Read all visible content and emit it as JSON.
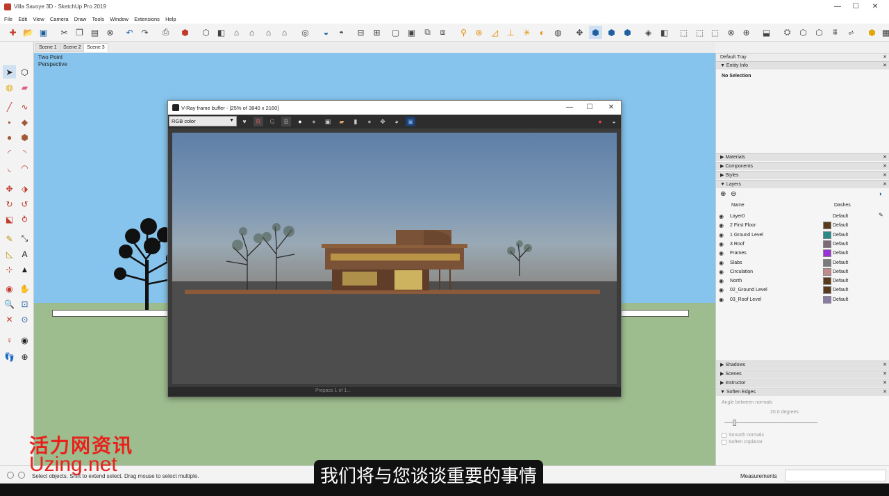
{
  "window": {
    "title": "Villa Savoye 3D - SketchUp Pro 2019"
  },
  "menu": [
    "File",
    "Edit",
    "View",
    "Camera",
    "Draw",
    "Tools",
    "Window",
    "Extensions",
    "Help"
  ],
  "scenes": {
    "tabs": [
      "Scene 1",
      "Scene 2",
      "Scene 3"
    ],
    "active": "Scene 3"
  },
  "viewport": {
    "label_line1": "Two Point",
    "label_line2": "Perspective"
  },
  "vfb": {
    "title": "V-Ray frame buffer - [25% of 3840 x 2160]",
    "channel": "RGB color",
    "channel_buttons": [
      "R",
      "G",
      "B"
    ],
    "status": "Prepass 1 of 1..."
  },
  "tray": {
    "title": "Default Tray",
    "entity_info": {
      "header": "Entity Info",
      "value": "No Selection"
    },
    "panels_top": [
      "Materials",
      "Components",
      "Styles",
      "Layers"
    ],
    "layers": {
      "col_name": "Name",
      "col_dashes": "Dashes",
      "rows": [
        {
          "name": "Layer0",
          "dashes": "Default",
          "color": ""
        },
        {
          "name": "2 First Floor",
          "dashes": "Default",
          "color": "#5a3a1a"
        },
        {
          "name": "1 Ground Level",
          "dashes": "Default",
          "color": "#2a8a8a"
        },
        {
          "name": "3 Roof",
          "dashes": "Default",
          "color": "#7a6a7a"
        },
        {
          "name": "Frames",
          "dashes": "Default",
          "color": "#9b32d6"
        },
        {
          "name": "Slabs",
          "dashes": "Default",
          "color": "#7a7a7a"
        },
        {
          "name": "Circulation",
          "dashes": "Default",
          "color": "#c28a8a"
        },
        {
          "name": "North",
          "dashes": "Default",
          "color": "#5a3a1a"
        },
        {
          "name": "02_Ground Level",
          "dashes": "Default",
          "color": "#5a3a1a"
        },
        {
          "name": "03_Roof Level",
          "dashes": "Default",
          "color": "#8a7aa6"
        }
      ]
    },
    "panels_bottom": [
      "Shadows",
      "Scenes",
      "Instructor",
      "Soften Edges"
    ],
    "soften": {
      "angle_label": "Angle between normals",
      "angle_value": "20.0 degrees",
      "smooth_normals": "Smooth normals",
      "soften_coplanar": "Soften coplanar"
    }
  },
  "status": {
    "text": "Select objects. Shift to extend select. Drag mouse to select multiple.",
    "measurements_label": "Measurements"
  },
  "overlay": {
    "subtitle": "我们将与您谈谈重要的事情",
    "watermark_cn": "活力网资讯",
    "watermark_en": "Uzing.net"
  },
  "colors": {
    "sky": "#86c4ed",
    "ground": "#9dbd8e",
    "watermark": "#e8211c"
  }
}
